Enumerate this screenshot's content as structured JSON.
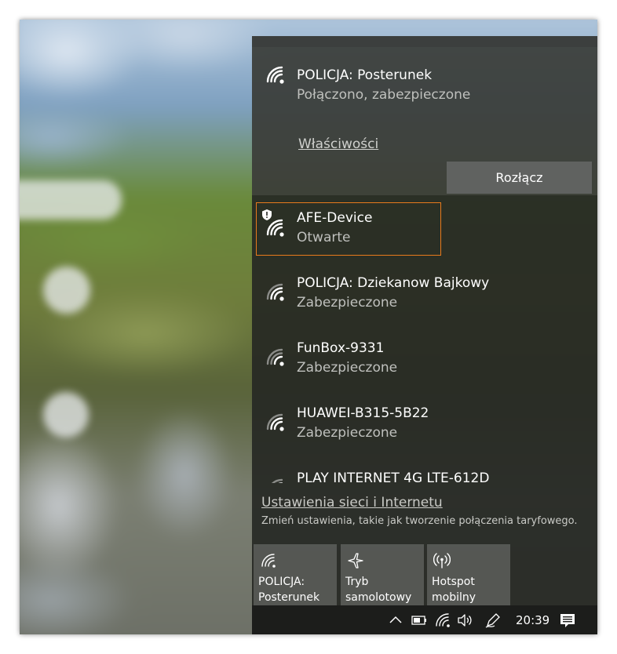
{
  "connected_network": {
    "name": "POLICJA: Posterunek",
    "status": "Połączono, zabezpieczone",
    "properties_link": "Właściwości",
    "disconnect_label": "Rozłącz"
  },
  "networks": [
    {
      "name": "AFE-Device",
      "status": "Otwarte",
      "open": true,
      "focused": true
    },
    {
      "name": "POLICJA: Dziekanow Bajkowy",
      "status": "Zabezpieczone"
    },
    {
      "name": "FunBox-9331",
      "status": "Zabezpieczone"
    },
    {
      "name": "HUAWEI-B315-5B22",
      "status": "Zabezpieczone"
    },
    {
      "name": "PLAY INTERNET 4G LTE-612D",
      "status": ""
    }
  ],
  "settings": {
    "link": "Ustawienia sieci i Internetu",
    "description": "Zmień ustawienia, takie jak tworzenie połączenia taryfowego."
  },
  "quick_actions": [
    {
      "label_line1": "POLICJA:",
      "label_line2": "Posterunek",
      "icon": "wifi-icon",
      "active": true
    },
    {
      "label_line1": "Tryb",
      "label_line2": "samolotowy",
      "icon": "airplane-icon",
      "active": false
    },
    {
      "label_line1": "Hotspot",
      "label_line2": "mobilny",
      "icon": "hotspot-icon",
      "active": false
    }
  ],
  "taskbar": {
    "clock": "20:39",
    "icons": [
      "chevron-up-icon",
      "battery-icon",
      "wifi-icon",
      "volume-icon",
      "pen-icon",
      "action-center-icon"
    ]
  },
  "colors": {
    "focus_border": "#e87a1c",
    "panel_bg": "#262824",
    "button_bg": "#606260"
  }
}
